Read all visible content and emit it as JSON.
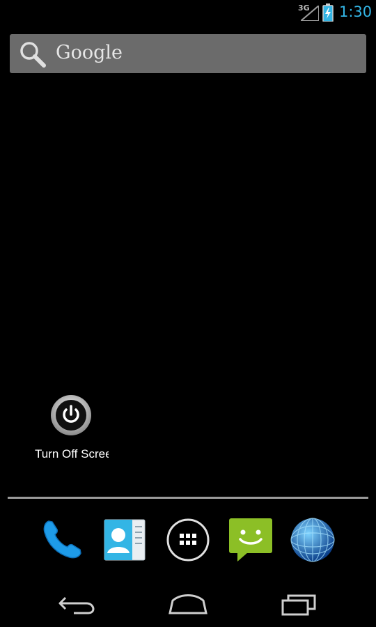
{
  "status_bar": {
    "network": "3G",
    "time": "1:30",
    "icons": [
      "signal-icon",
      "battery-charging-icon"
    ]
  },
  "search": {
    "label": "Google",
    "icon": "search-icon"
  },
  "widget": {
    "label": "Turn Off Scree",
    "icon": "power-icon"
  },
  "dock": {
    "items": [
      {
        "name": "phone",
        "icon": "phone-icon"
      },
      {
        "name": "contacts",
        "icon": "contacts-icon"
      },
      {
        "name": "all-apps",
        "icon": "grid-icon"
      },
      {
        "name": "messaging",
        "icon": "message-icon"
      },
      {
        "name": "browser",
        "icon": "globe-icon"
      }
    ]
  },
  "nav": {
    "items": [
      "back-icon",
      "home-icon",
      "recents-icon"
    ]
  },
  "colors": {
    "accent": "#33b5e5",
    "search_bg": "#6b6b6b",
    "message_green": "#8cbf26",
    "background": "#000000"
  }
}
